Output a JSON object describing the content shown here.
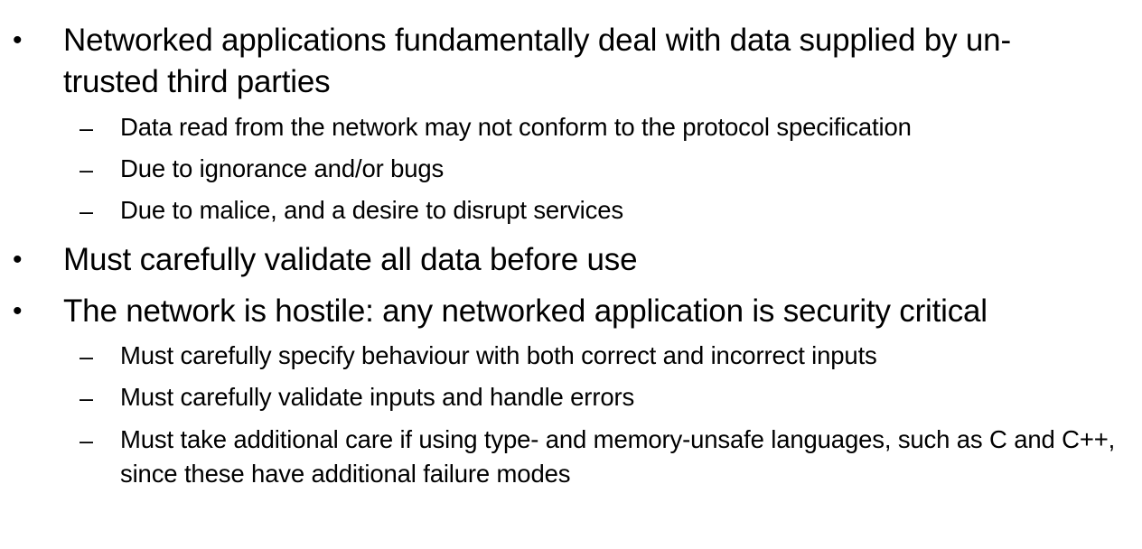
{
  "bullet_glyph": "•",
  "dash_glyph": "–",
  "bullets": [
    {
      "text": "Networked applications fundamentally deal with data supplied by un-trusted third parties",
      "subs": [
        "Data read from the network may not conform to the protocol specification",
        "Due to ignorance and/or bugs",
        "Due to malice, and a desire to disrupt services"
      ]
    },
    {
      "text": "Must carefully validate all data before use",
      "subs": []
    },
    {
      "text": "The network is hostile: any networked application is security critical",
      "subs": [
        "Must carefully specify behaviour with both correct and incorrect inputs",
        "Must carefully validate inputs and handle errors",
        "Must take additional care if using type- and memory-unsafe languages, such as C and C++, since these have additional failure modes"
      ]
    }
  ]
}
